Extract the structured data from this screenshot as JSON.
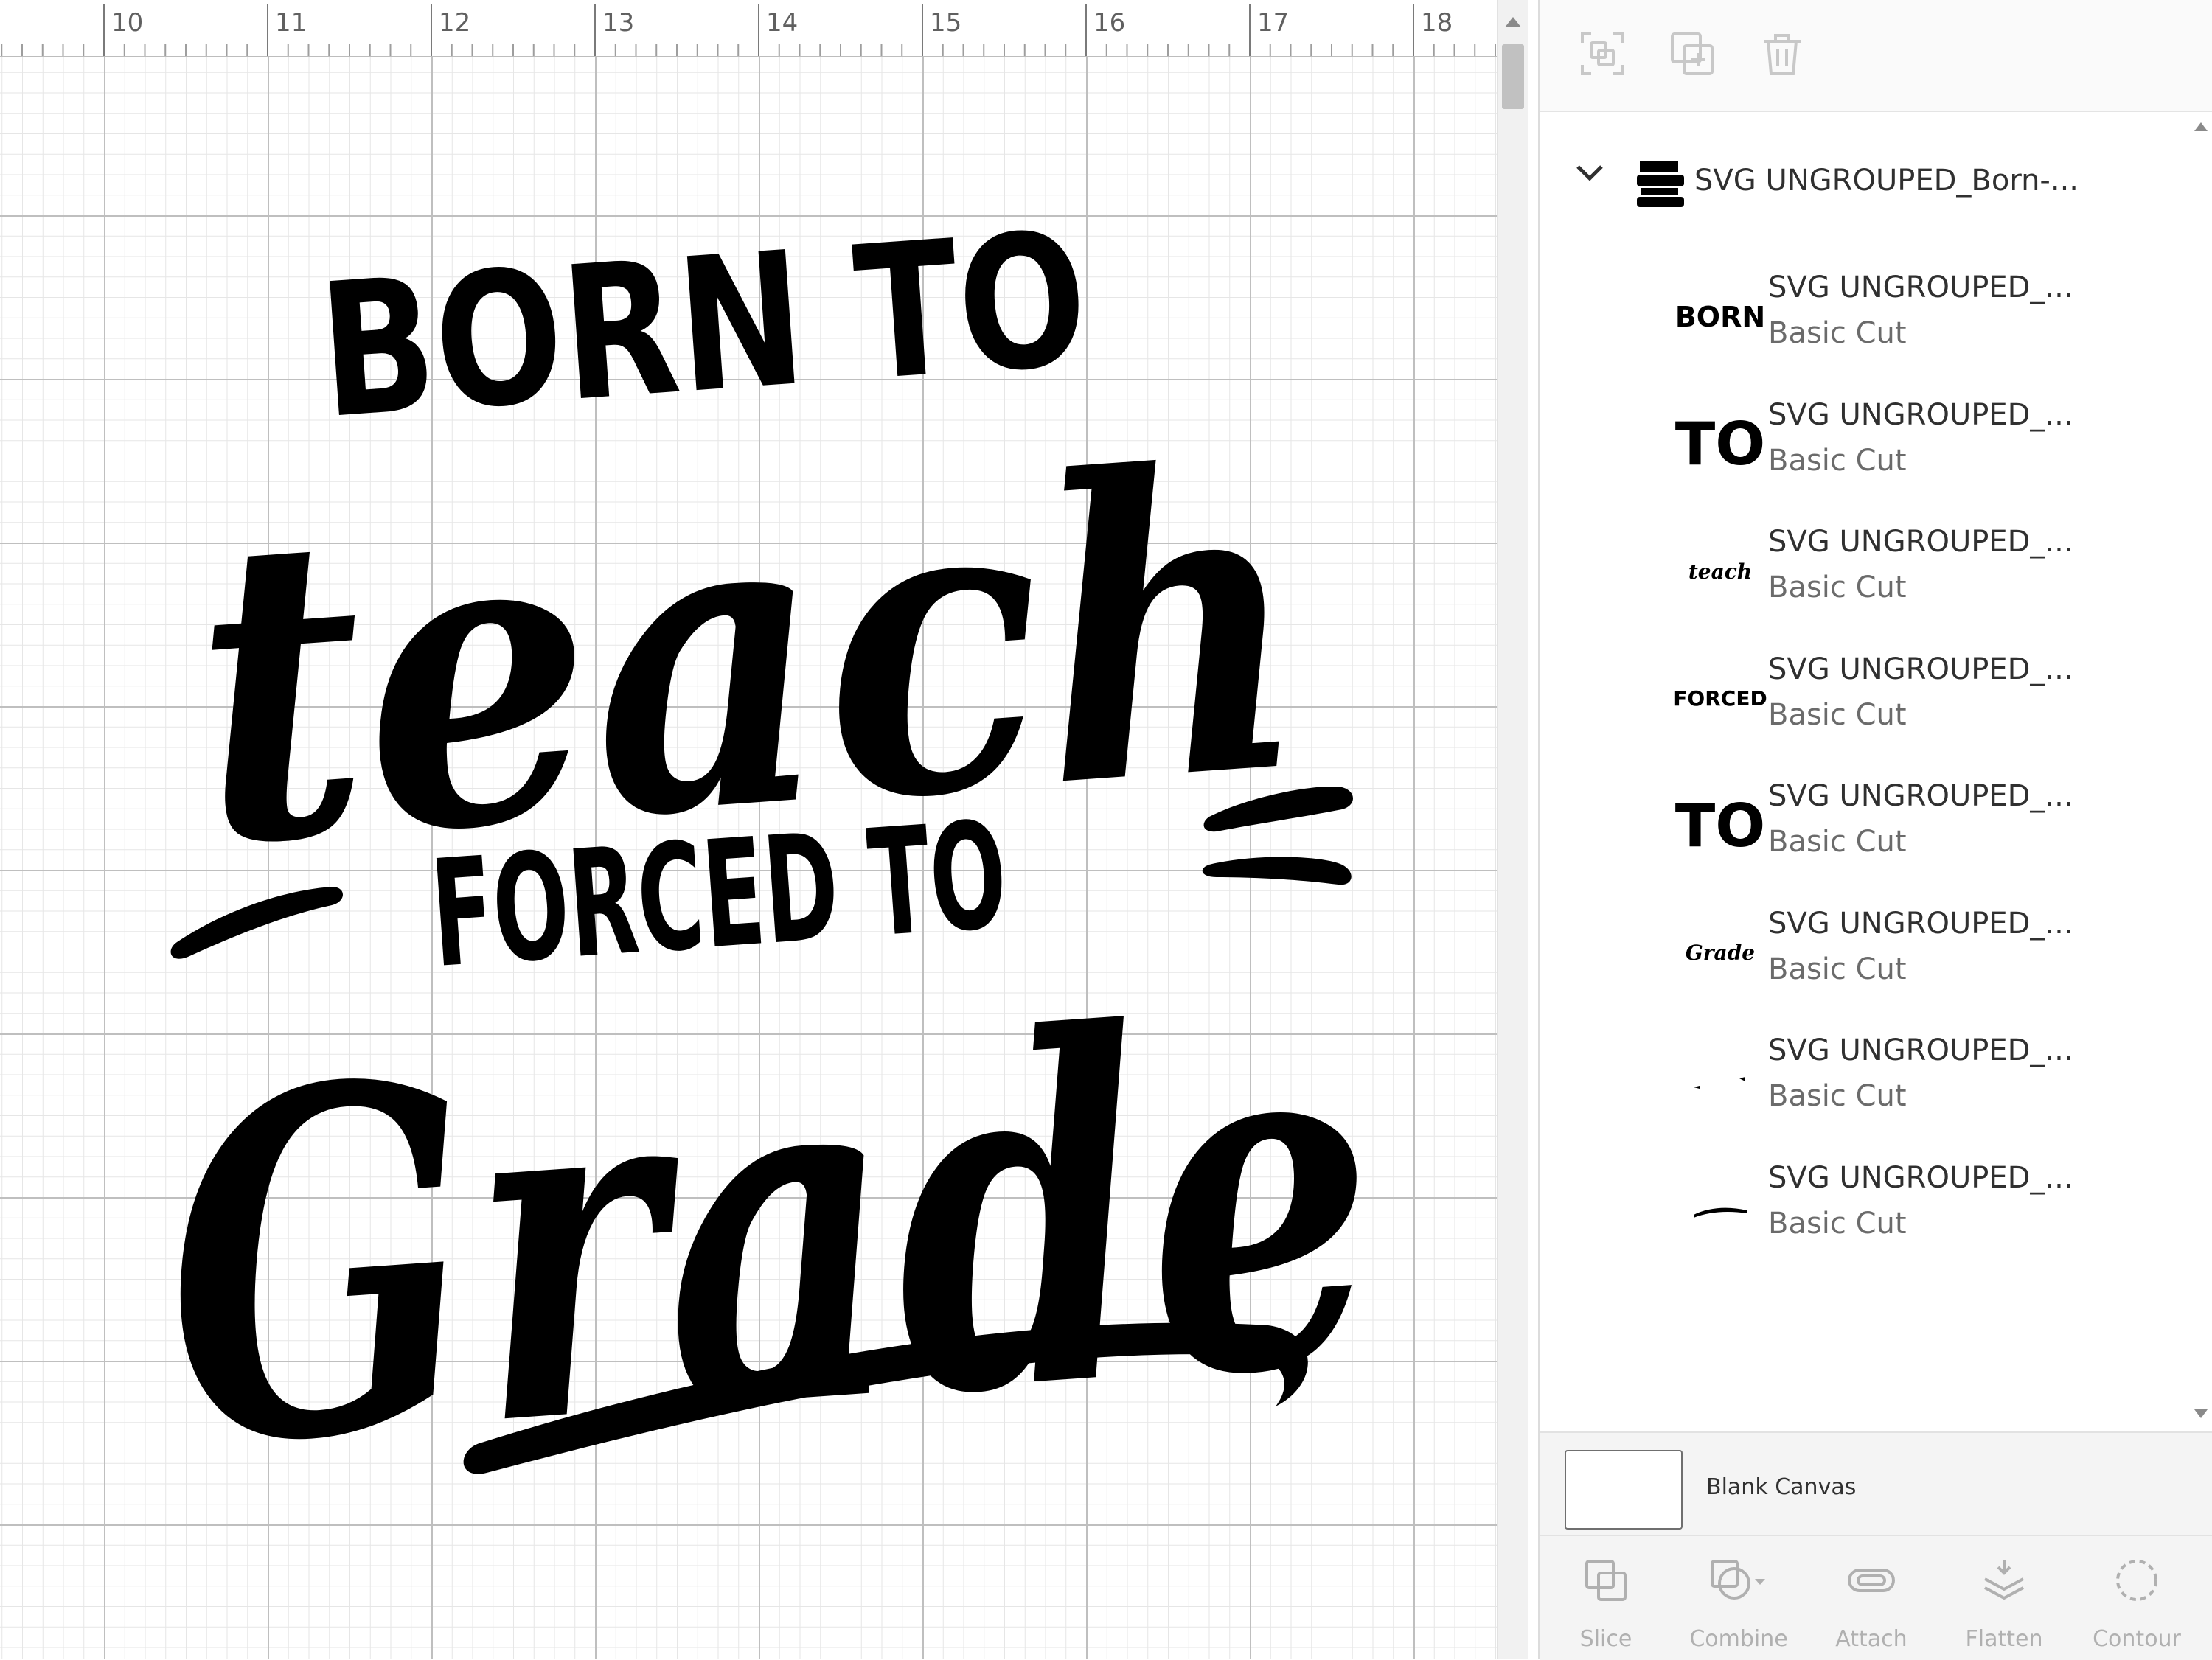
{
  "ruler": {
    "ticks": [
      "10",
      "11",
      "12",
      "13",
      "14",
      "15",
      "16",
      "17",
      "18"
    ]
  },
  "artwork": {
    "lines": [
      "BORN TO",
      "teach",
      "FORCED TO",
      "Grade"
    ]
  },
  "layer_toolbar": {
    "icons": [
      "group-icon",
      "duplicate-icon",
      "delete-icon"
    ]
  },
  "layers": {
    "group": {
      "name": "SVG UNGROUPED_Born-...",
      "thumbnail": "design-thumbnail-icon"
    },
    "items": [
      {
        "name": "SVG UNGROUPED_...",
        "operation": "Basic Cut",
        "thumb_text": "BORN"
      },
      {
        "name": "SVG UNGROUPED_...",
        "operation": "Basic Cut",
        "thumb_text": "TO"
      },
      {
        "name": "SVG UNGROUPED_...",
        "operation": "Basic Cut",
        "thumb_text": "teach"
      },
      {
        "name": "SVG UNGROUPED_...",
        "operation": "Basic Cut",
        "thumb_text": "FORCED"
      },
      {
        "name": "SVG UNGROUPED_...",
        "operation": "Basic Cut",
        "thumb_text": "TO"
      },
      {
        "name": "SVG UNGROUPED_...",
        "operation": "Basic Cut",
        "thumb_text": "Grade"
      },
      {
        "name": "SVG UNGROUPED_...",
        "operation": "Basic Cut",
        "thumb_text": ""
      },
      {
        "name": "SVG UNGROUPED_...",
        "operation": "Basic Cut",
        "thumb_text": ""
      }
    ]
  },
  "canvas": {
    "label": "Blank Canvas"
  },
  "bottom_toolbar": {
    "slice": "Slice",
    "combine": "Combine",
    "attach": "Attach",
    "flatten": "Flatten",
    "contour": "Contour"
  },
  "colors": {
    "ink": "#000000",
    "disabled": "#b0b0b0",
    "grid_major": "#bfbfbf",
    "grid_minor": "#e6e6e6"
  }
}
